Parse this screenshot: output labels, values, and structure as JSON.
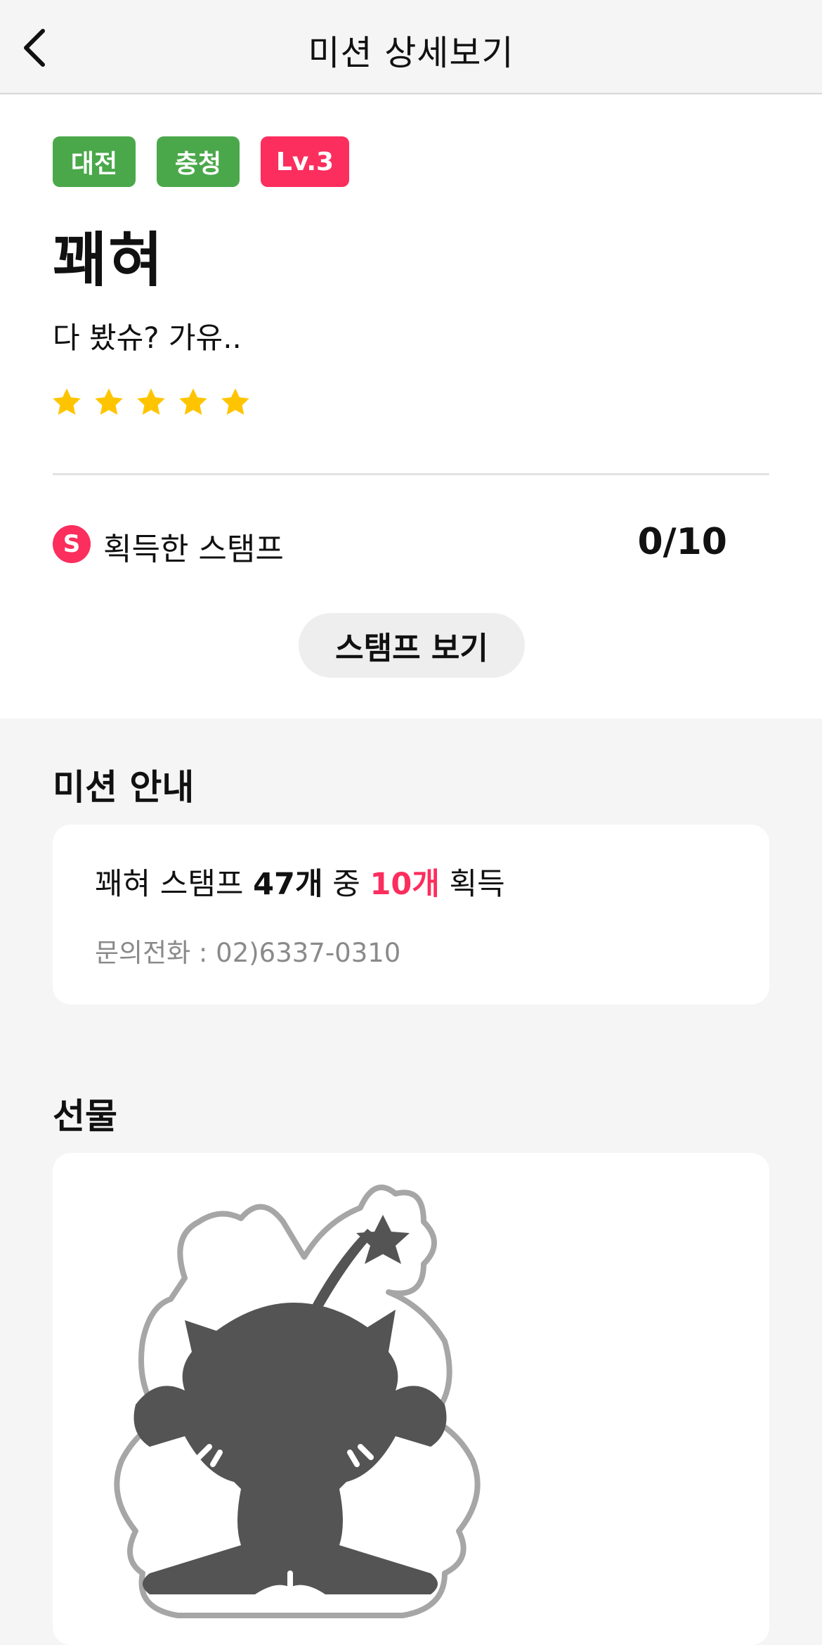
{
  "header": {
    "title": "미션 상세보기",
    "back_icon": "chevron-left-icon"
  },
  "mission": {
    "tags": [
      {
        "label": "대전",
        "color": "#4aa84a"
      },
      {
        "label": "충청",
        "color": "#4aa84a"
      },
      {
        "label": "Lv.3",
        "color": "#fb2e5e"
      }
    ],
    "title": "꽤혀",
    "subtitle": "다 봤슈? 가유..",
    "rating": {
      "value": 5,
      "max": 5,
      "star_color": "#ffc400"
    }
  },
  "stamps": {
    "badge_letter": "S",
    "label": "획득한 스탬프",
    "count": "0/10",
    "view_button": "스탬프 보기"
  },
  "mission_info": {
    "section_title": "미션 안내",
    "line_prefix": "꽤혀 스탬프",
    "total": "47개",
    "middle": "중",
    "required": "10개",
    "suffix": "획득",
    "phone": "문의전화 : 02)6337-0310"
  },
  "gift": {
    "section_title": "선물",
    "image_icon": "mascot-image"
  },
  "colors": {
    "accent": "#fb2e5e",
    "region_tag": "#4aa84a",
    "background": "#f5f5f5"
  }
}
